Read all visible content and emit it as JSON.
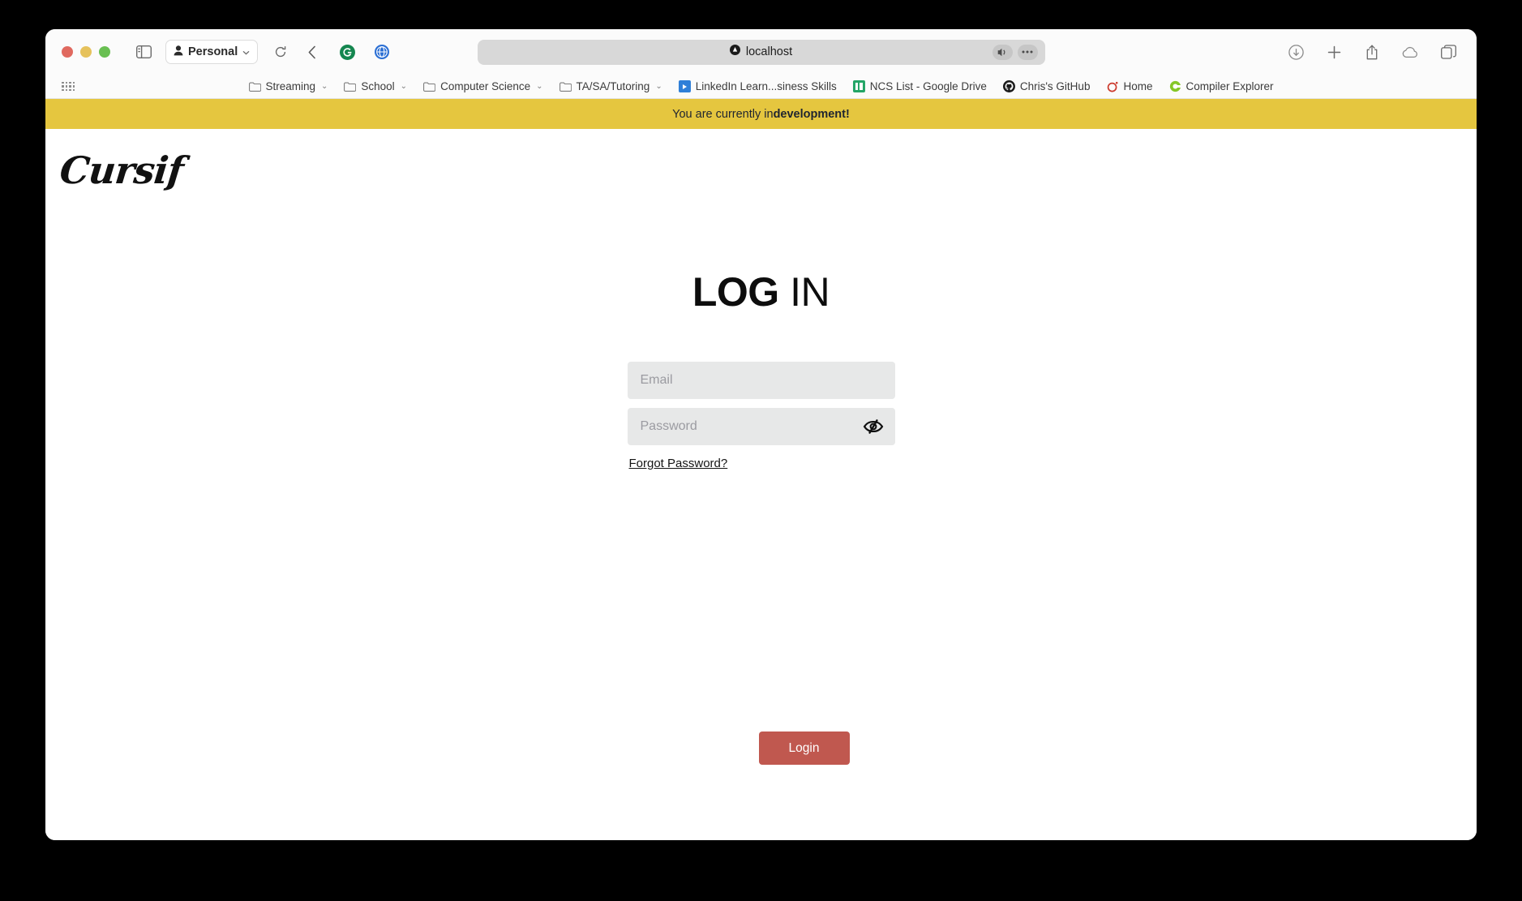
{
  "browser": {
    "profile_label": "Personal",
    "address": "localhost",
    "traffic_lights": [
      "close",
      "minimize",
      "maximize"
    ],
    "toolbar_right_icons": [
      "download-icon",
      "new-tab-icon",
      "share-icon",
      "icloud-icon",
      "tab-overview-icon"
    ],
    "address_icons": [
      "site-lock-icon",
      "mute-icon",
      "more-icon"
    ],
    "bookmarks": [
      {
        "label": "Streaming",
        "icon": "folder-icon",
        "has_chevron": true
      },
      {
        "label": "School",
        "icon": "folder-icon",
        "has_chevron": true
      },
      {
        "label": "Computer Science",
        "icon": "folder-icon",
        "has_chevron": true
      },
      {
        "label": "TA/SA/Tutoring",
        "icon": "folder-icon",
        "has_chevron": true
      },
      {
        "label": "LinkedIn Learn...siness Skills",
        "icon": "linkedin-icon",
        "has_chevron": false
      },
      {
        "label": "NCS List - Google Drive",
        "icon": "google-sheets-icon",
        "has_chevron": false
      },
      {
        "label": "Chris's GitHub",
        "icon": "github-icon",
        "has_chevron": false
      },
      {
        "label": "Home",
        "icon": "home-ring-icon",
        "has_chevron": false
      },
      {
        "label": "Compiler Explorer",
        "icon": "compiler-explorer-icon",
        "has_chevron": false
      }
    ]
  },
  "banner": {
    "prefix": "You are currently in ",
    "environment": "development!",
    "background": "#e5c63f"
  },
  "page": {
    "logo_text": "Cursif",
    "heading_bold": "LOG",
    "heading_thin": " IN",
    "form": {
      "email_placeholder": "Email",
      "email_value": "",
      "password_placeholder": "Password",
      "password_value": "",
      "toggle_password_icon": "eye-slash-icon",
      "forgot_password_label": "Forgot Password?",
      "submit_label": "Login",
      "submit_color": "#c0584f",
      "field_background": "#e7e8e8"
    }
  }
}
